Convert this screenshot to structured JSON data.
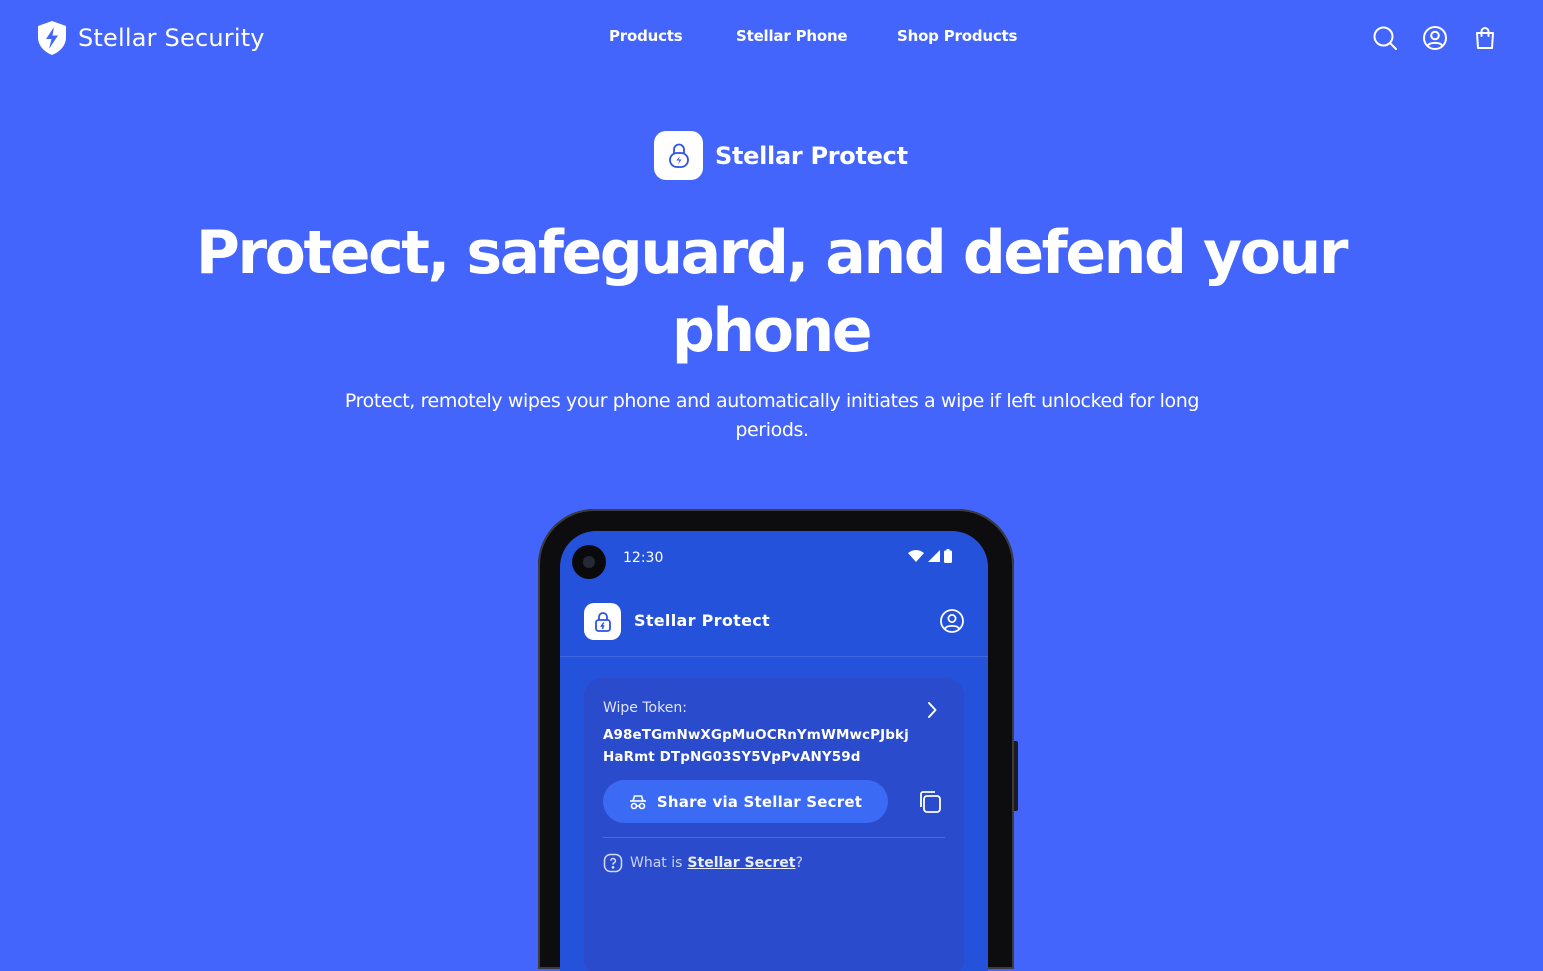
{
  "brand": {
    "name": "Stellar Security"
  },
  "nav": {
    "items": [
      {
        "label": "Products"
      },
      {
        "label": "Stellar Phone"
      },
      {
        "label": "Shop Products"
      }
    ],
    "icons": [
      "search-icon",
      "account-icon",
      "cart-icon"
    ]
  },
  "hero": {
    "product_name": "Stellar Protect",
    "headline": "Protect, safeguard, and defend your phone",
    "subheadline": "Protect, remotely wipes your phone and automatically initiates a wipe if left unlocked for long periods."
  },
  "phone": {
    "status_time": "12:30",
    "app_title": "Stellar Protect",
    "token_label": "Wipe Token:",
    "token_value": "A98eTGmNwXGpMuOCRnYmWMwcPJbkjHaRmt DTpNG03SY5VpPvANY59d",
    "share_label": "Share via Stellar Secret",
    "help_prefix": "What is",
    "help_link": "Stellar Secret",
    "help_suffix": "?"
  },
  "colors": {
    "background": "#4465fb",
    "screen": "#2552da",
    "card": "#2a4bcb",
    "button": "#3b6af5"
  }
}
